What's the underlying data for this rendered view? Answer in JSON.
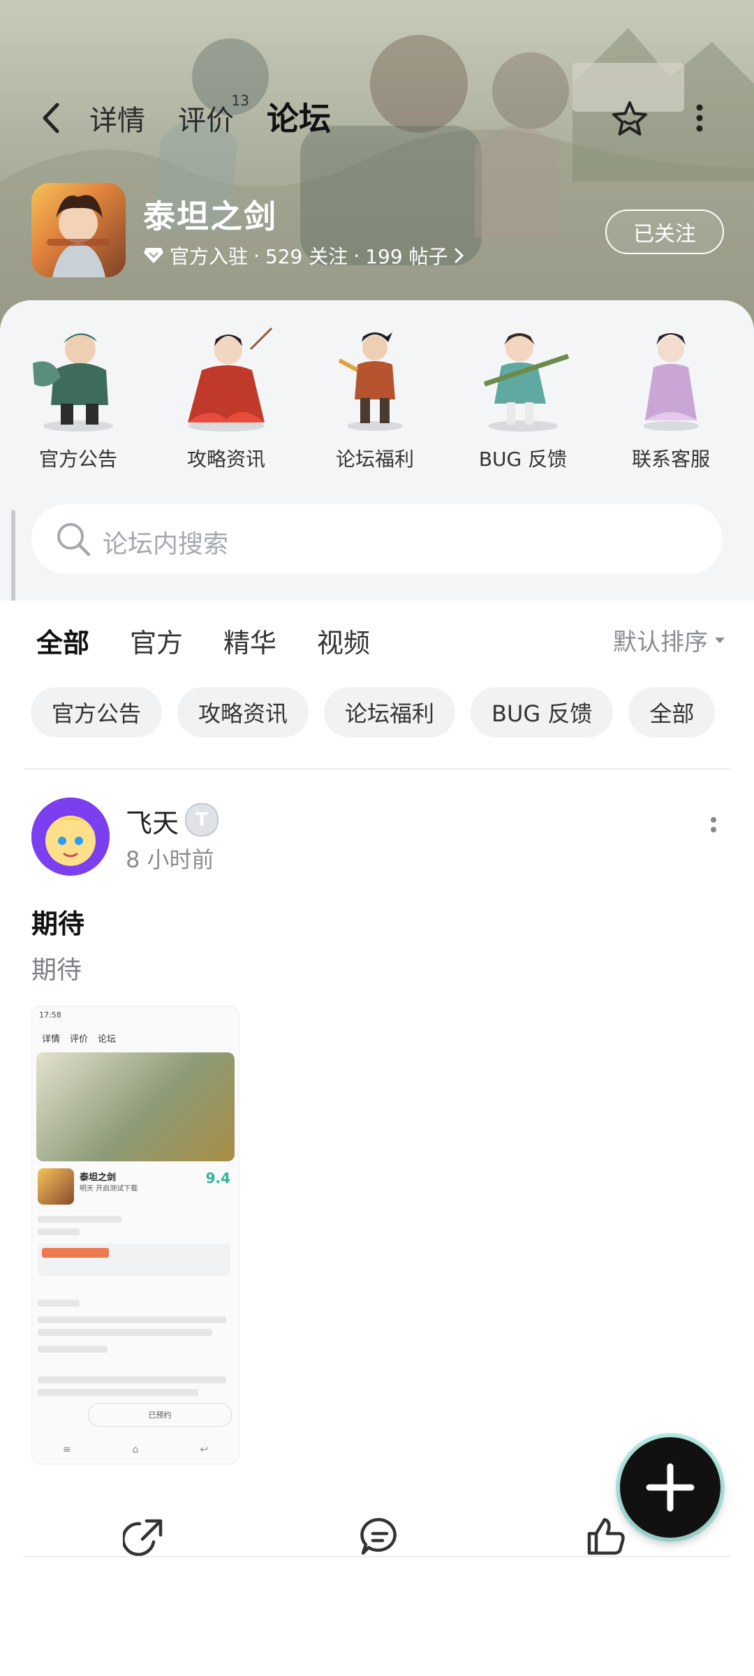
{
  "header": {
    "tabs": [
      {
        "label": "详情"
      },
      {
        "label": "评价",
        "badge": "13"
      },
      {
        "label": "论坛",
        "active": true
      }
    ]
  },
  "game": {
    "title": "泰坦之剑",
    "official": "官方入驻",
    "separator": "·",
    "followers": "529 关注",
    "posts": "199 帖子",
    "follow_button": "已关注"
  },
  "quick_links": [
    {
      "label": "官方公告"
    },
    {
      "label": "攻略资讯"
    },
    {
      "label": "论坛福利"
    },
    {
      "label": "BUG 反馈"
    },
    {
      "label": "联系客服"
    }
  ],
  "search": {
    "placeholder": "论坛内搜索"
  },
  "filter_tabs": [
    {
      "label": "全部",
      "active": true
    },
    {
      "label": "官方"
    },
    {
      "label": "精华"
    },
    {
      "label": "视频"
    }
  ],
  "sort": {
    "label": "默认排序"
  },
  "chips": [
    "官方公告",
    "攻略资讯",
    "论坛福利",
    "BUG 反馈",
    "全部"
  ],
  "post": {
    "author": "飞天",
    "badge": "T",
    "time": "8 小时前",
    "title": "期待",
    "body": "期待",
    "thumbnail": {
      "status_time": "17:58",
      "nav": [
        "详情",
        "评价",
        "论坛"
      ],
      "game_name": "泰坦之剑",
      "game_sub": "明天 开启测试下载",
      "score": "9.4",
      "reserve": "已预约"
    }
  },
  "colors": {
    "accent": "#2fc7b1",
    "sheet_bg": "#f4f5f7"
  }
}
